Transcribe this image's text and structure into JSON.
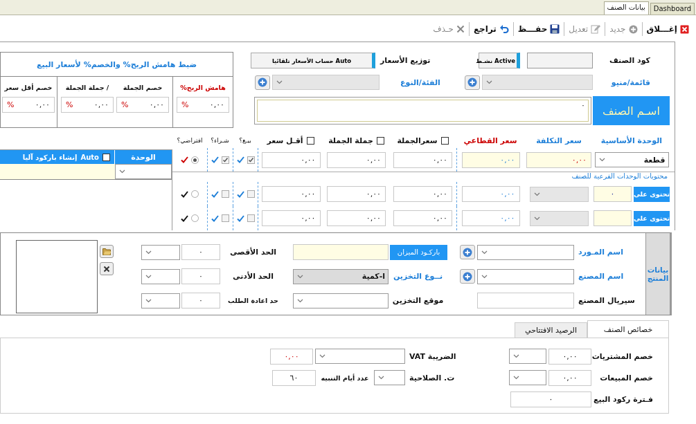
{
  "tabs": [
    {
      "label": "Dashboard",
      "selected": false
    },
    {
      "label": "بيانات الصنف",
      "selected": true
    }
  ],
  "toolbar": [
    {
      "label": "إغـــلاق",
      "kind": "close",
      "disabled": false
    },
    {
      "label": "جديد",
      "kind": "add",
      "disabled": true
    },
    {
      "label": "تعديل",
      "kind": "edit",
      "disabled": true
    },
    {
      "label": "حفـــظ",
      "kind": "save",
      "disabled": false
    },
    {
      "label": "تراجع",
      "kind": "undo",
      "disabled": false
    },
    {
      "label": "حـذف",
      "kind": "delete",
      "disabled": true
    }
  ],
  "item": {
    "code_label": "كود الصنف",
    "active": {
      "label": "Active نشـط",
      "on": true
    },
    "pricing_label": "توزيع الأسعار",
    "auto_pricing": {
      "label": "Auto حساب الأسعار تلقائيا",
      "on": true
    },
    "menu_label": "قائمة/منيو",
    "category_label": "الفئة/النوع",
    "name_label": "اسـم الصنف",
    "name_value": "٠"
  },
  "margins": {
    "title": "ضبط هامش الربح% والخصم% لأسعار البيع",
    "groups": [
      [
        {
          "label": "هامش الربح%",
          "value": "٠,٠٠",
          "unit": "%",
          "highlight": true
        }
      ],
      [
        {
          "label": "خصم الجملة",
          "value": "٠,٠٠",
          "unit": "%",
          "highlight": false
        },
        {
          "label": "/  جملة الجملة",
          "value": "٠,٠٠",
          "unit": "%",
          "highlight": false
        }
      ],
      [
        {
          "label": "خصم أقل سعر",
          "value": "٠,٠٠",
          "unit": "%",
          "highlight": false
        }
      ]
    ]
  },
  "price_headers": [
    {
      "label": "الوحدة الأساسية",
      "color": "#1e7fd8"
    },
    {
      "label": "سعر التكلفة",
      "color": "#1e7fd8"
    },
    {
      "label": "سعر القطاعي",
      "color": "#cc0000"
    }
  ],
  "price_checks": [
    {
      "label": "سعرالجملة",
      "checked": false
    },
    {
      "label": "جملة الجملة",
      "checked": false
    },
    {
      "label": "أقـل سعر",
      "checked": false
    }
  ],
  "flag_headers": [
    "بيـع؟",
    "شـراء؟",
    "افتراضي؟"
  ],
  "base_unit": {
    "unit": "قطعة",
    "cost": "٠,٠٠",
    "retail": "٠,٠٠",
    "prices": [
      "٠,٠٠",
      "٠,٠٠",
      "٠,٠٠"
    ],
    "sell": true,
    "buy": true,
    "default": true
  },
  "sub_units": {
    "caption": "محتويات الوحدات الفرعية للصنف",
    "rows": [
      {
        "label": "تحتوى على",
        "quantity": "٠",
        "retail": "٠,٠٠",
        "prices": [
          "٠,٠٠",
          "٠,٠٠",
          "٠,٠٠"
        ],
        "sell": false,
        "buy": false,
        "default": false
      },
      {
        "label": "تحتوى على",
        "retail": "٠,٠٠",
        "prices": [
          "٠,٠٠",
          "٠,٠٠",
          "٠,٠٠"
        ],
        "sell": false,
        "buy": false,
        "default": false
      }
    ]
  },
  "barcode": {
    "unit_header": "الوحدة",
    "auto_label": "Auto",
    "auto_checked": false,
    "header": "إنشاء باركود آليا"
  },
  "product": {
    "title": "بيانات المنتج",
    "supplier_label": "اسم المـورد",
    "maker_label": "اسم المصنع",
    "serial_label": "سيريال المصنع",
    "scale_barcode_label": "باركـود الميزان",
    "storage_type_label": "نــوع التخزين",
    "storage_type": "ا-كمية",
    "location_label": "موقع التخزين",
    "limits": [
      {
        "label": "الحد الأقصى",
        "value": "٠"
      },
      {
        "label": "الحد الأدنى",
        "value": "٠"
      },
      {
        "label": "حد اعادة الطلب",
        "value": "٠"
      }
    ]
  },
  "property_tabs": [
    {
      "label": "خصائص الصنف",
      "selected": true
    },
    {
      "label": "الرصيد الافتتاحي",
      "selected": false
    }
  ],
  "properties": {
    "purchase_discount": {
      "label": "خصم المشتريات",
      "value": "٠,٠٠"
    },
    "vat": {
      "label": "الضريبة VAT",
      "value": "٠,٠٠"
    },
    "sales_discount": {
      "label": "خصم المبيعات",
      "value": "٠,٠٠"
    },
    "expiry_label": "ت. الصلاحية",
    "alert_days": {
      "label": "عدد أيام التنبيه",
      "value": "٦٠"
    },
    "stagnation": {
      "label": "فـترة ركود البيع",
      "value": "٠"
    }
  }
}
